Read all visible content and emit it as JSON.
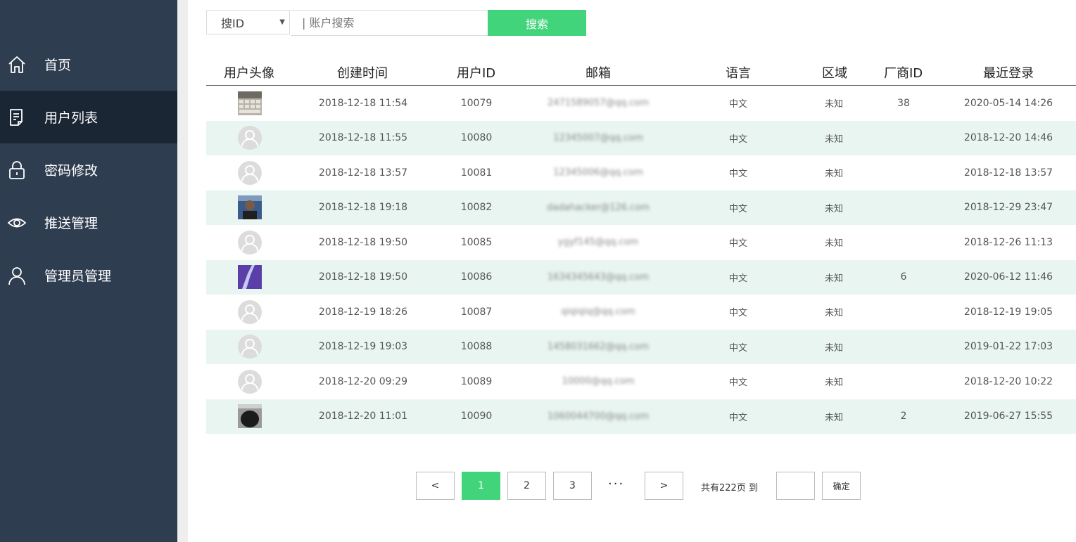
{
  "sidebar": {
    "items": [
      {
        "label": "首页",
        "icon": "home-icon"
      },
      {
        "label": "用户列表",
        "icon": "document-icon",
        "active": true
      },
      {
        "label": "密码修改",
        "icon": "lock-icon"
      },
      {
        "label": "推送管理",
        "icon": "eye-icon"
      },
      {
        "label": "管理员管理",
        "icon": "user-icon"
      }
    ]
  },
  "search": {
    "select_value": "搜ID",
    "placeholder": "| 账户搜索",
    "button_label": "搜索"
  },
  "table": {
    "headers": [
      "用户头像",
      "创建时间",
      "用户ID",
      "邮箱",
      "语言",
      "区域",
      "厂商ID",
      "最近登录"
    ],
    "rows": [
      {
        "avatar": "keyboard-photo",
        "created": "2018-12-18 11:54",
        "uid": "10079",
        "email": "2471589057@qq.com",
        "lang": "中文",
        "region": "未知",
        "vendor": "38",
        "last_login": "2020-05-14 14:26"
      },
      {
        "avatar": "default",
        "created": "2018-12-18 11:55",
        "uid": "10080",
        "email": "12345007@qq.com",
        "lang": "中文",
        "region": "未知",
        "vendor": "",
        "last_login": "2018-12-20 14:46"
      },
      {
        "avatar": "default",
        "created": "2018-12-18 13:57",
        "uid": "10081",
        "email": "12345006@qq.com",
        "lang": "中文",
        "region": "未知",
        "vendor": "",
        "last_login": "2018-12-18 13:57"
      },
      {
        "avatar": "person-photo",
        "created": "2018-12-18 19:18",
        "uid": "10082",
        "email": "dadahacker@126.com",
        "lang": "中文",
        "region": "未知",
        "vendor": "",
        "last_login": "2018-12-29 23:47"
      },
      {
        "avatar": "default",
        "created": "2018-12-18 19:50",
        "uid": "10085",
        "email": "ygyf145@qq.com",
        "lang": "中文",
        "region": "未知",
        "vendor": "",
        "last_login": "2018-12-26 11:13"
      },
      {
        "avatar": "purple-photo",
        "created": "2018-12-18 19:50",
        "uid": "10086",
        "email": "1634345643@qq.com",
        "lang": "中文",
        "region": "未知",
        "vendor": "6",
        "last_login": "2020-06-12 11:46"
      },
      {
        "avatar": "default",
        "created": "2018-12-19 18:26",
        "uid": "10087",
        "email": "qiqiqiq@qq.com",
        "lang": "中文",
        "region": "未知",
        "vendor": "",
        "last_login": "2018-12-19 19:05"
      },
      {
        "avatar": "default",
        "created": "2018-12-19 19:03",
        "uid": "10088",
        "email": "1458031662@qq.com",
        "lang": "中文",
        "region": "未知",
        "vendor": "",
        "last_login": "2019-01-22 17:03"
      },
      {
        "avatar": "default",
        "created": "2018-12-20 09:29",
        "uid": "10089",
        "email": "10000@qq.com",
        "lang": "中文",
        "region": "未知",
        "vendor": "",
        "last_login": "2018-12-20 10:22"
      },
      {
        "avatar": "dark-photo",
        "created": "2018-12-20 11:01",
        "uid": "10090",
        "email": "1060044700@qq.com",
        "lang": "中文",
        "region": "未知",
        "vendor": "2",
        "last_login": "2019-06-27 15:55"
      }
    ]
  },
  "pagination": {
    "prev": "<",
    "pages": [
      "1",
      "2",
      "3"
    ],
    "current": "1",
    "ellipsis": "···",
    "next": ">",
    "total_text": "共有222页  到",
    "confirm_label": "确定"
  },
  "colors": {
    "sidebar_bg": "#2f3d50",
    "sidebar_active": "#1b2634",
    "accent": "#41d47b",
    "row_alt": "#e8f5f0"
  }
}
